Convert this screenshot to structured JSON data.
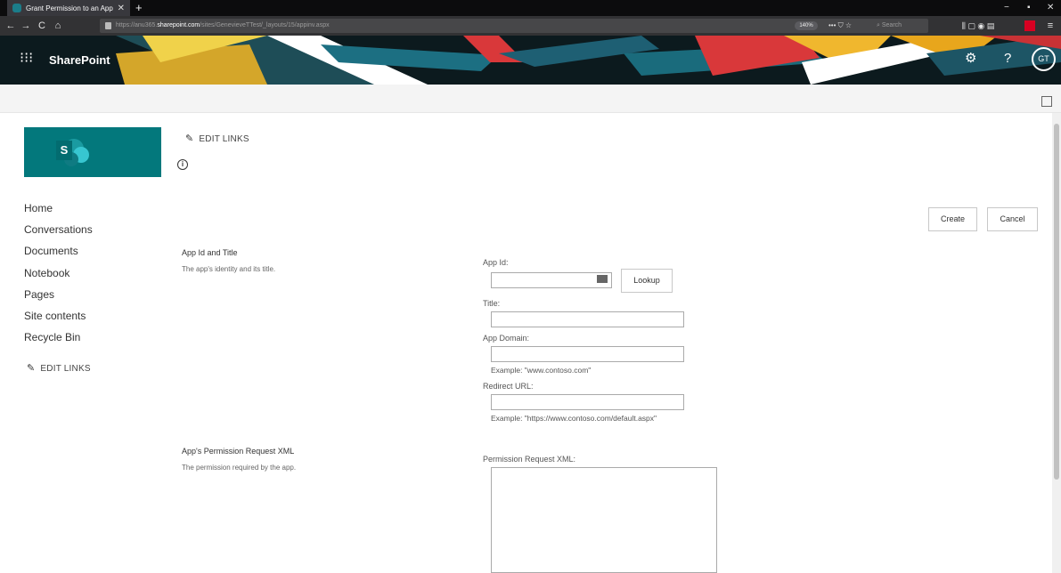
{
  "browser": {
    "tab_title": "Grant Permission to an App",
    "tab_close": "✕",
    "new_tab": "+",
    "url_host_prefix": "https://anu365.",
    "url_host": "sharepoint.com",
    "url_path": "/sites/GenevieveTTest/_layouts/15/appinv.aspx",
    "zoom": "140%",
    "page_actions": "••• ⛉ ☆",
    "search_placeholder": "Search",
    "toolbar_icons": "⫼ ▢ ◉ ▤",
    "menu_icon": "≡",
    "nav_back": "←",
    "nav_forward": "→",
    "nav_reload": "C",
    "nav_home": "⌂",
    "minimize": "−",
    "restore": "▪",
    "close": "✕"
  },
  "suitebar": {
    "waffle": "⁝⁝⁝",
    "brand": "SharePoint",
    "settings_icon": "⚙",
    "help_icon": "?",
    "user_initials": "GT"
  },
  "header": {
    "edit_links": "EDIT LINKS",
    "info_icon": "i"
  },
  "leftnav": {
    "items": [
      "Home",
      "Conversations",
      "Documents",
      "Notebook",
      "Pages",
      "Site contents",
      "Recycle Bin"
    ],
    "edit_links": "EDIT LINKS"
  },
  "logo": {
    "letter": "S"
  },
  "actions": {
    "create": "Create",
    "cancel": "Cancel"
  },
  "form": {
    "section1": {
      "title": "App Id and Title",
      "desc": "The app's identity and its title."
    },
    "app_id_label": "App Id:",
    "app_id_value": "",
    "lookup": "Lookup",
    "title_label": "Title:",
    "title_value": "",
    "app_domain_label": "App Domain:",
    "app_domain_value": "",
    "app_domain_example": "Example: \"www.contoso.com\"",
    "redirect_label": "Redirect URL:",
    "redirect_value": "",
    "redirect_example": "Example: \"https://www.contoso.com/default.aspx\"",
    "section2": {
      "title": "App's Permission Request XML",
      "desc": "The permission required by the app."
    },
    "xml_label": "Permission Request XML:",
    "xml_value": ""
  },
  "colors": {
    "accent": "#03787c",
    "suitebar": "#0c1a1e",
    "chrome": "#323234"
  }
}
